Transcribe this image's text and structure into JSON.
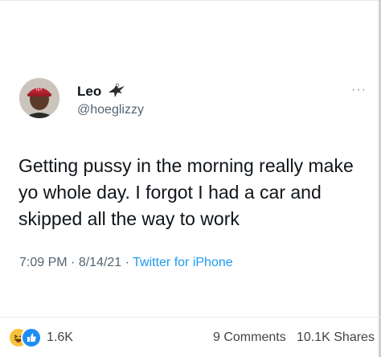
{
  "tweet": {
    "author_name": "Leo",
    "author_handle": "@hoeglizzy",
    "more_label": "···",
    "text": "Getting pussy in the morning really make yo whole day. I forgot I had a car and skipped all the way to work",
    "time": "7:09 PM",
    "date": "8/14/21",
    "source": "Twitter for iPhone",
    "separator": " · "
  },
  "post_footer": {
    "reaction_count": "1.6K",
    "comments": "9 Comments",
    "shares": "10.1K Shares",
    "reaction_icons": [
      "haha-reaction-icon",
      "like-reaction-icon"
    ]
  },
  "colors": {
    "text": "#0f1419",
    "muted": "#536471",
    "link": "#1d9bf0",
    "like_blue": "#1d8df6",
    "haha_yellow": "#f7c23b"
  }
}
